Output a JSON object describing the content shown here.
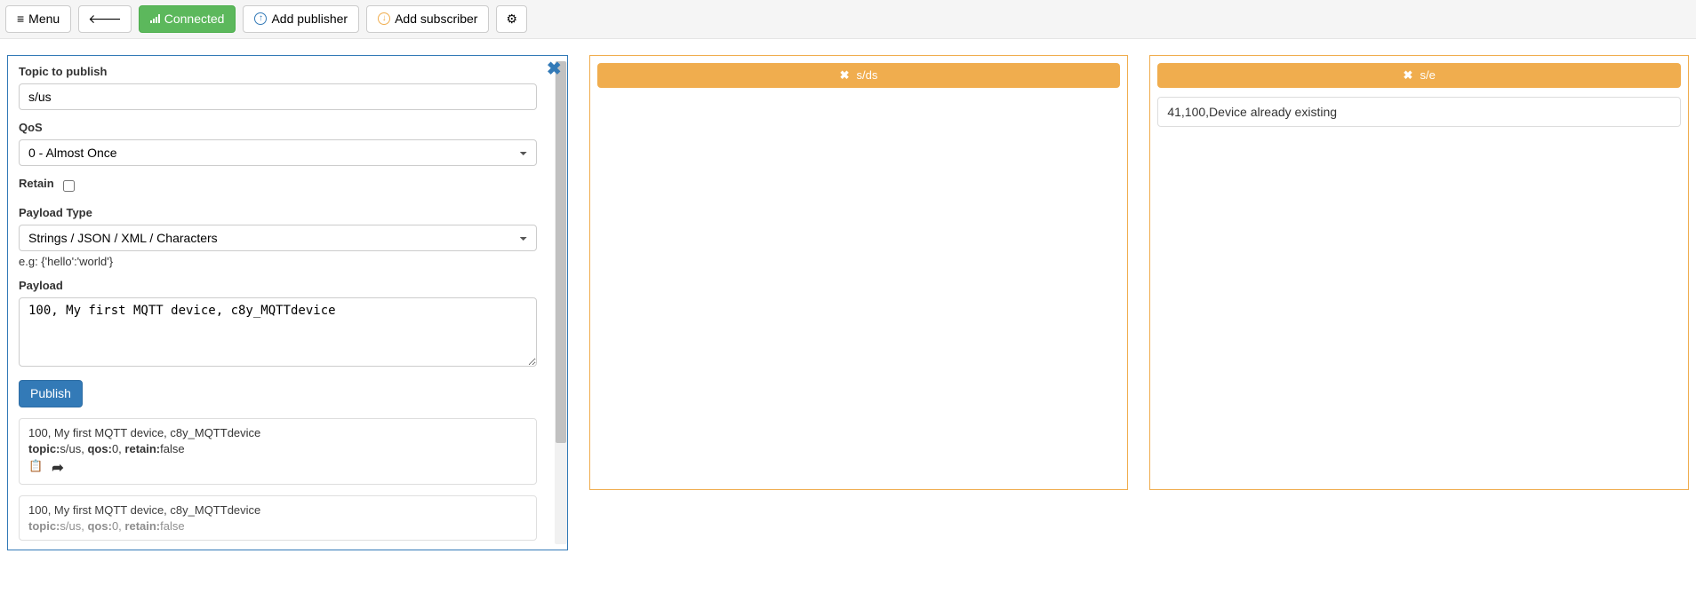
{
  "toolbar": {
    "menu_label": "Menu",
    "connected_label": "Connected",
    "add_publisher_label": "Add publisher",
    "add_subscriber_label": "Add subscriber"
  },
  "publisher": {
    "topic_label": "Topic to publish",
    "topic_value": "s/us",
    "qos_label": "QoS",
    "qos_value": "0 - Almost Once",
    "retain_label": "Retain",
    "retain_checked": false,
    "payload_type_label": "Payload Type",
    "payload_type_value": "Strings / JSON / XML / Characters",
    "payload_type_hint": "e.g: {'hello':'world'}",
    "payload_label": "Payload",
    "payload_value": "100, My first MQTT device, c8y_MQTTdevice",
    "publish_button": "Publish",
    "history": [
      {
        "payload": "100, My first MQTT device, c8y_MQTTdevice",
        "topic_label": "topic:",
        "topic_value": "s/us,",
        "qos_label": "qos:",
        "qos_value": "0,",
        "retain_label": "retain:",
        "retain_value": "false"
      },
      {
        "payload": "100, My first MQTT device, c8y_MQTTdevice",
        "topic_label": "topic:",
        "topic_value": "s/us,",
        "qos_label": "qos:",
        "qos_value": "0,",
        "retain_label": "retain:",
        "retain_value": "false"
      }
    ]
  },
  "subscribers": [
    {
      "topic": "s/ds",
      "messages": []
    },
    {
      "topic": "s/e",
      "messages": [
        "41,100,Device already existing"
      ]
    }
  ]
}
